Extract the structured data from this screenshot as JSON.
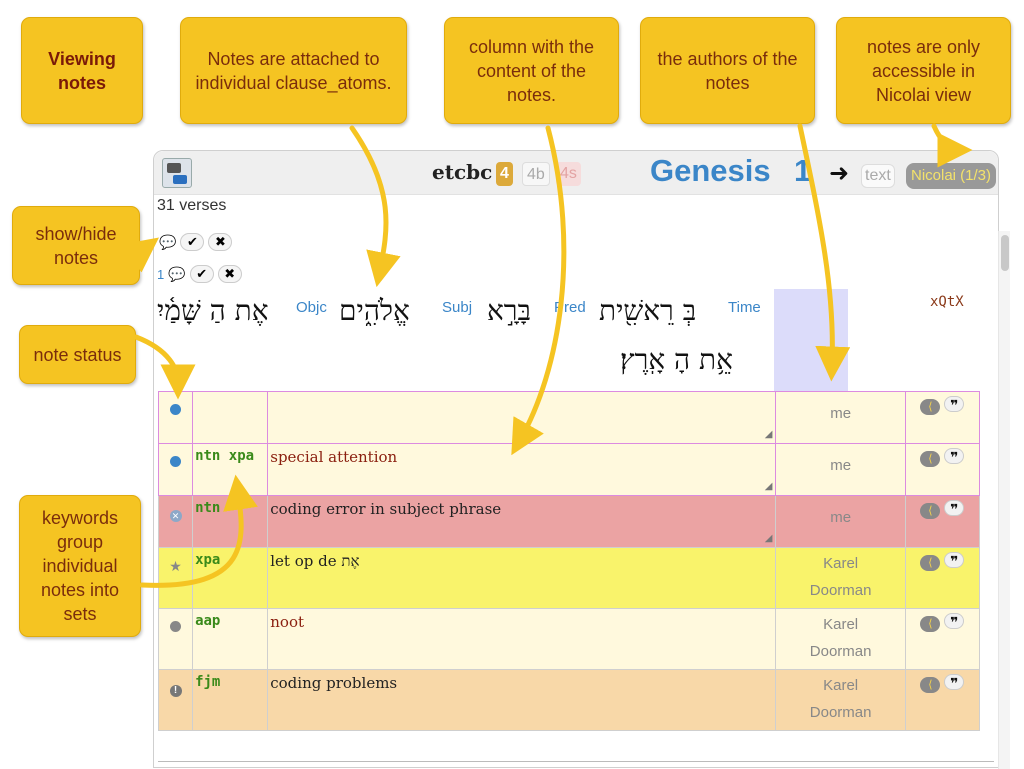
{
  "callouts": {
    "viewing": "Viewing notes",
    "attached": "Notes are attached to individual clause_atoms.",
    "column": "column with the content of the notes.",
    "authors": "the authors of the notes",
    "nicolai_only": "notes are only accessible in Nicolai view",
    "showhide": "show/hide notes",
    "status": "note status",
    "keywords": "keywords group individual notes into sets"
  },
  "toolbar": {
    "brand": "etcbc",
    "versions": [
      "4",
      "4b",
      "4s"
    ],
    "book": "Genesis",
    "chapter": "1",
    "next_icon": "➜",
    "text_btn": "text",
    "view_btn": "Nicolai (1/3)"
  },
  "verses": "31 verses",
  "controls": {
    "row1": {
      "check": "✔",
      "cross": "✖"
    },
    "row2": {
      "num": "1",
      "check": "✔",
      "cross": "✖"
    }
  },
  "clause": {
    "line1": "אֶת הַ שָּׁמַ֫יִ",
    "objc_word": "אֵ֥ת הַ שָּׁמַ֖יִם",
    "subj_word": "אֱלֹהִ֑ים",
    "pred_word": "בָּרָ֣א",
    "time_word": "בְּ רֵאשִׁ֖ית",
    "line2": "אֵ֥ת הָ אָֽרֶץ׃",
    "labels": {
      "objc": "Objc",
      "subj": "Subj",
      "pred": "Pred",
      "time": "Time"
    },
    "code": "xQtX"
  },
  "notes": [
    {
      "status": "blue",
      "keywords": "",
      "text": "",
      "author": "me",
      "bg": "light",
      "edit": true
    },
    {
      "status": "blue",
      "keywords": "ntn xpa",
      "text": "special attention",
      "author": "me",
      "bg": "light",
      "edit": true
    },
    {
      "status": "x",
      "keywords": "ntn",
      "text": "coding error in subject phrase",
      "author": "me",
      "bg": "red",
      "edit": true
    },
    {
      "status": "star",
      "keywords": "xpa",
      "text": "let op de אֶת",
      "author": "Karel Doorman",
      "bg": "yellow",
      "edit": false
    },
    {
      "status": "gray",
      "keywords": "aap",
      "text": "noot",
      "author": "Karel Doorman",
      "bg": "light",
      "edit": false
    },
    {
      "status": "exclaim",
      "keywords": "fjm",
      "text": "coding problems",
      "author": "Karel Doorman",
      "bg": "orange",
      "edit": false
    }
  ],
  "colors": {
    "callout_bg": "#f5c422",
    "callout_text": "#7a2d0c",
    "accent_blue": "#3b86c8",
    "keyword_green": "#3a8a1a"
  }
}
